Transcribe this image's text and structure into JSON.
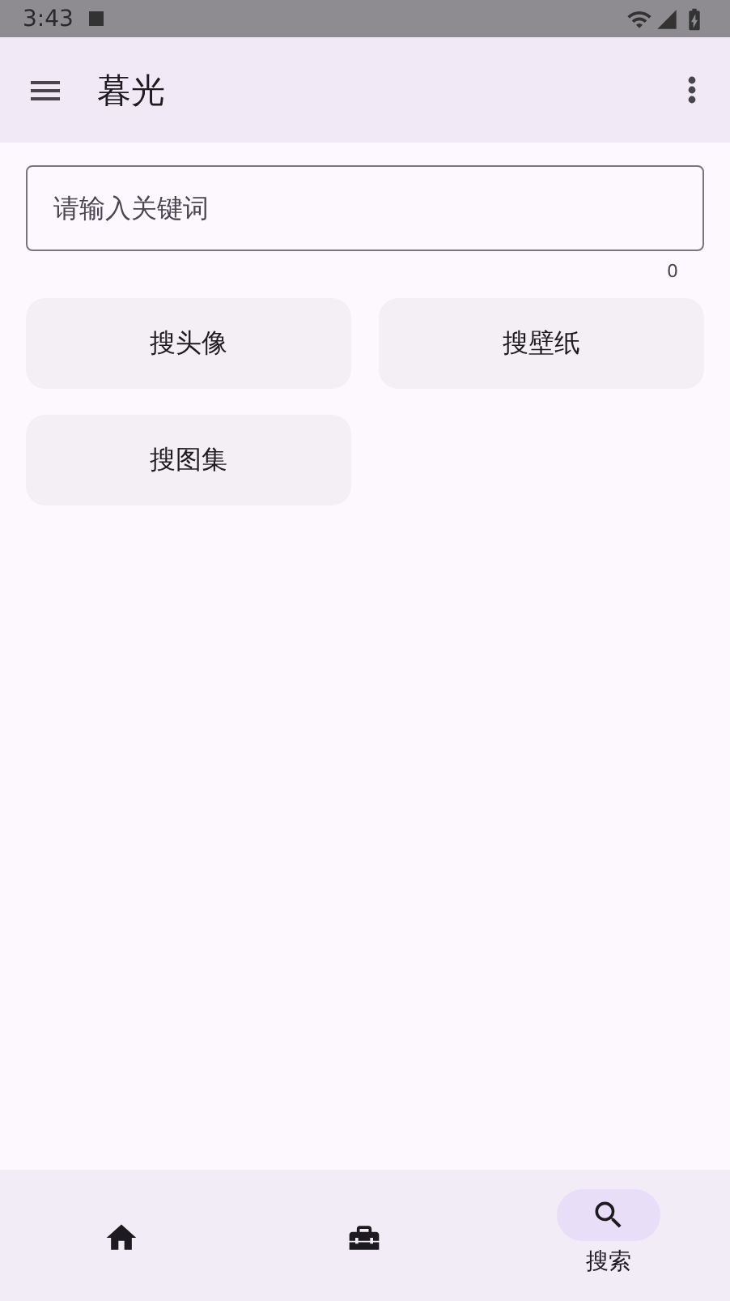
{
  "status_bar": {
    "time": "3:43"
  },
  "app_bar": {
    "title": "暮光"
  },
  "search": {
    "placeholder": "请输入关键词",
    "counter": "0"
  },
  "buttons": [
    "搜头像",
    "搜壁纸",
    "搜图集"
  ],
  "bottom_nav": [
    {
      "selected": false
    },
    {
      "selected": false
    },
    {
      "selected": true,
      "label": "搜索"
    }
  ]
}
